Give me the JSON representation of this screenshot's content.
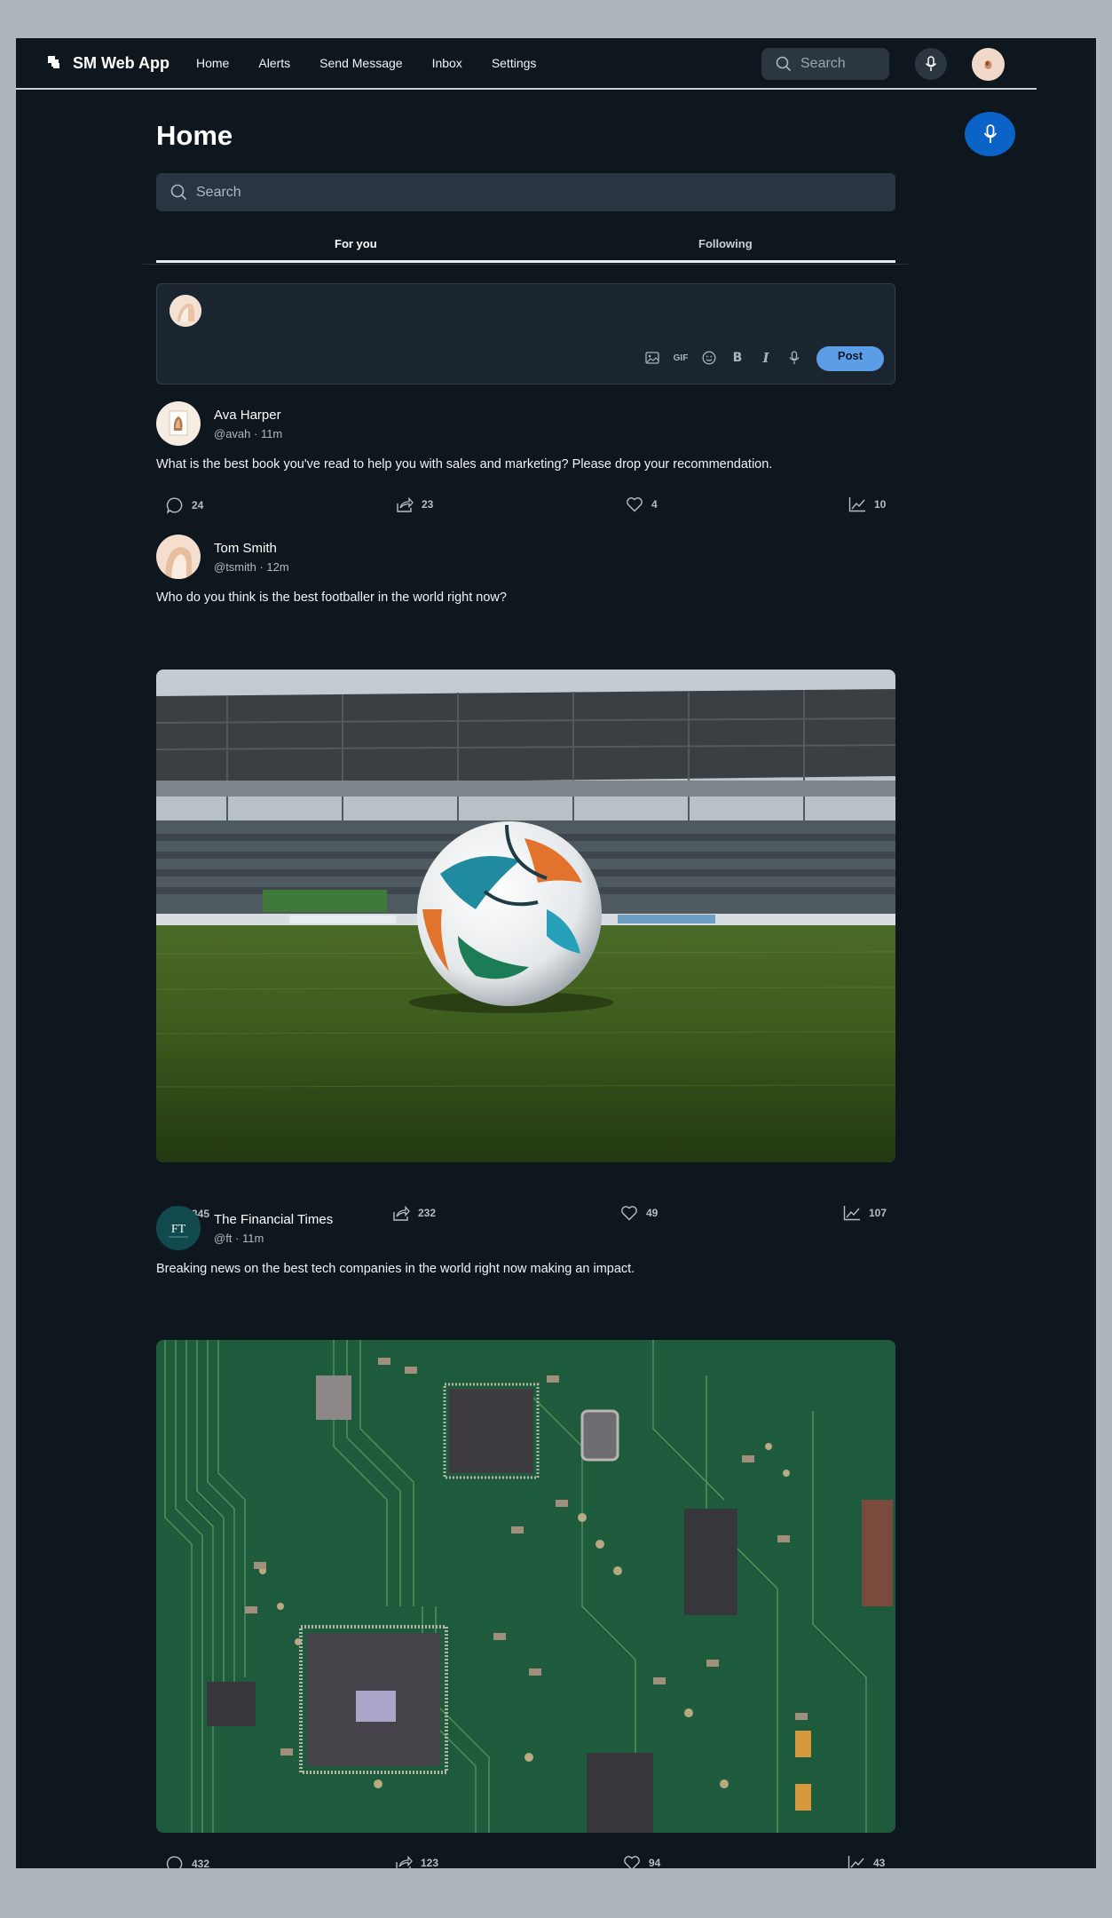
{
  "nav": {
    "brand": "SM Web App",
    "links": [
      "Home",
      "Alerts",
      "Send Message",
      "Inbox",
      "Settings"
    ],
    "search_placeholder": "Search"
  },
  "main": {
    "title": "Home",
    "search_placeholder": "Search",
    "tabs": [
      "For you",
      "Following"
    ],
    "active_tab": "For you"
  },
  "composer": {
    "tools": [
      "image-icon",
      "GIF",
      "emoji-icon",
      "B",
      "I",
      "mic-icon"
    ],
    "gif_label": "GIF",
    "bold_label": "B",
    "italic_label": "I",
    "post_label": "Post"
  },
  "posts": [
    {
      "name": "Ava Harper",
      "meta": "@avah · 11m",
      "text": "What is the best book you've read to help you with sales and marketing? Please drop your recommendation.",
      "replies": "24",
      "shares": "23",
      "likes": "4",
      "views": "10"
    },
    {
      "name": "Tom Smith",
      "meta": "@tsmith · 12m",
      "text": "Who do you think is the best footballer in the world right now?",
      "image": "football-on-stadium-grass",
      "replies": "345",
      "shares": "232",
      "likes": "49",
      "views": "107"
    },
    {
      "name": "The Financial Times",
      "meta": "@ft · 11m",
      "avatar_text": "FT",
      "text": "Breaking news on the best tech companies in the world right now making an impact.",
      "image": "green-circuit-board",
      "replies": "432",
      "shares": "123",
      "likes": "94",
      "views": "43"
    }
  ],
  "colors": {
    "background": "#0f171e",
    "accent": "#0b63c8",
    "post_button": "#5b9de6",
    "surface": "#293540"
  }
}
